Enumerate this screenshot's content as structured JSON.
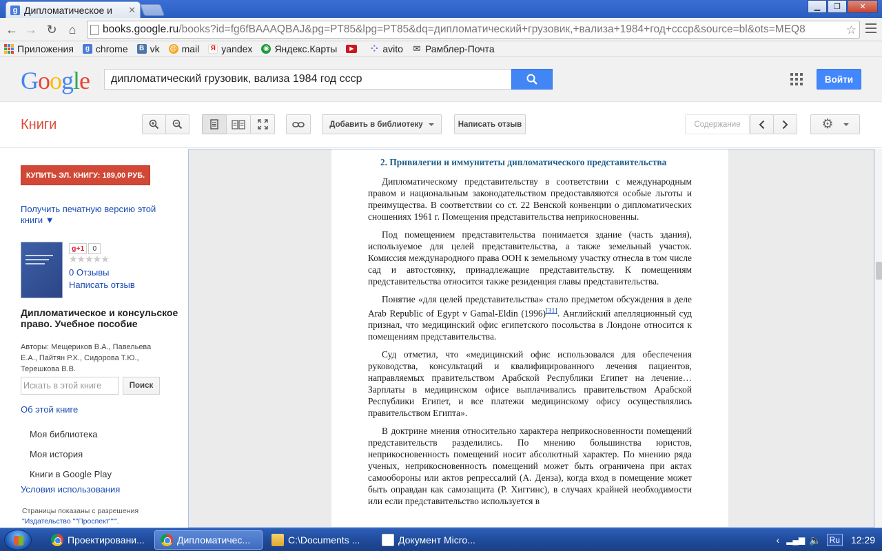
{
  "browser": {
    "tab_title": "Дипломатическое и",
    "tab_favicon": "g",
    "url_host": "books.google.ru",
    "url_path": "/books?id=fg6fBAAAQBAJ&pg=PT85&lpg=PT85&dq=дипломатический+грузовик,+вализа+1984+год+ссср&source=bl&ots=MEQ8",
    "bookmarks": [
      {
        "label": "Приложения",
        "icon": "apps-icon",
        "color": "#e94235"
      },
      {
        "label": "chrome",
        "icon": "google-icon",
        "color": "#4a7bd8"
      },
      {
        "label": "vk",
        "icon": "vk-icon",
        "color": "#4a76a8"
      },
      {
        "label": "mail",
        "icon": "mail-icon",
        "color": "#168de2"
      },
      {
        "label": "yandex",
        "icon": "yandex-icon",
        "color": "#e61400"
      },
      {
        "label": "Яндекс.Карты",
        "icon": "maps-icon",
        "color": "#1e9b3a"
      },
      {
        "label": "",
        "icon": "youtube-icon",
        "color": "#cc181e"
      },
      {
        "label": "avito",
        "icon": "avito-icon",
        "color": "#7b5cd6"
      },
      {
        "label": "Рамблер-Почта",
        "icon": "rambler-icon",
        "color": "#333333"
      }
    ]
  },
  "google": {
    "logo": [
      "G",
      "o",
      "o",
      "g",
      "l",
      "e"
    ],
    "logo_colors": [
      "#4285f4",
      "#ea4335",
      "#fbbc05",
      "#4285f4",
      "#34a853",
      "#ea4335"
    ],
    "search_query": "дипломатический грузовик, вализа 1984 год ссср",
    "login_label": "Войти"
  },
  "books_toolbar": {
    "title": "Книги",
    "add_library": "Добавить в библиотеку",
    "write_review": "Написать отзыв",
    "contents": "Содержание"
  },
  "sidebar": {
    "buy_button": "КУПИТЬ ЭЛ. КНИГУ: 189,00 РУБ.",
    "print_version": "Получить печатную версию этой книги ▼",
    "gplus_label": "g+1",
    "gplus_count": "0",
    "stars": "★★★★★",
    "reviews": "0 Отзывы",
    "write_review": "Написать отзыв",
    "book_title": "Дипломатическое и консульское право. Учебное пособие",
    "authors": "Авторы: Мещериков В.А., Павельева Е.А., Пайтян Р.Х., Сидорова Т.Ю., Терешкова В.В.",
    "search_placeholder": "Искать в этой книге",
    "search_button": "Поиск",
    "about": "Об этой книге",
    "my_library": "Моя библиотека",
    "my_history": "Моя история",
    "google_play": "Книги в Google Play",
    "terms": "Условия использования",
    "permission_text": "Страницы показаны с разрешения",
    "permission_publisher": "\"Издательство \"\"Проспект\"\"\"."
  },
  "book_page": {
    "heading": "2. Привилегии и иммунитеты дипломатического представительства",
    "p1": "Дипломатическому представительству в соответствии с международным правом и национальным законодательством предоставляются особые льготы и преимущества. В соответствии со ст. 22 Венской конвенции о дипломатических сношениях 1961 г. Помещения представительства неприкосновенны.",
    "p2": "Под помещением представительства понимается здание (часть здания), используемое для целей представительства, а также земельный участок. Комиссия международного права ООН к земельному участку отнесла в том числе сад и автостоянку, принадлежащие представительству. К помещениям представительства относится также резиденция главы представительства.",
    "p3a": "Понятие «для целей представительства» стало предметом обсуждения в деле Arab Republic of Egypt v Gamal-Eldin (1996)",
    "p3_footnote": "[31]",
    "p3b": ". Английский апелляционный суд признал, что медицинский офис египетского посольства в Лондоне относится к помещениям представительства.",
    "p4": "Суд отметил, что «медицинский офис использовался для обеспечения руководства, консультаций и квалифицированного лечения пациентов, направляемых правительством Арабской Республики Египет на лечение… Зарплаты в медицинском офисе выплачивались правительством Арабской Республики Египет, и все платежи медицинскому офису осуществлялись правительством Египта».",
    "p5": "В доктрине мнения относительно характера неприкосновенности помещений представительств разделились. По мнению большинства юристов, неприкосновенность помещений носит абсолютный характер. По мнению ряда ученых, неприкосновенность помещений может быть ограничена при актах самообороны или актов репрессалий (А. Денза), когда вход в помещение может быть оправдан как самозащита (Р. Хиггинс), в случаях крайней необходимости или если представительство используется в"
  },
  "taskbar": {
    "items": [
      "Проектировани...",
      "Дипломатичес...",
      "C:\\Documents ...",
      "Документ Micro..."
    ],
    "lang": "Ru",
    "time": "12:29"
  }
}
